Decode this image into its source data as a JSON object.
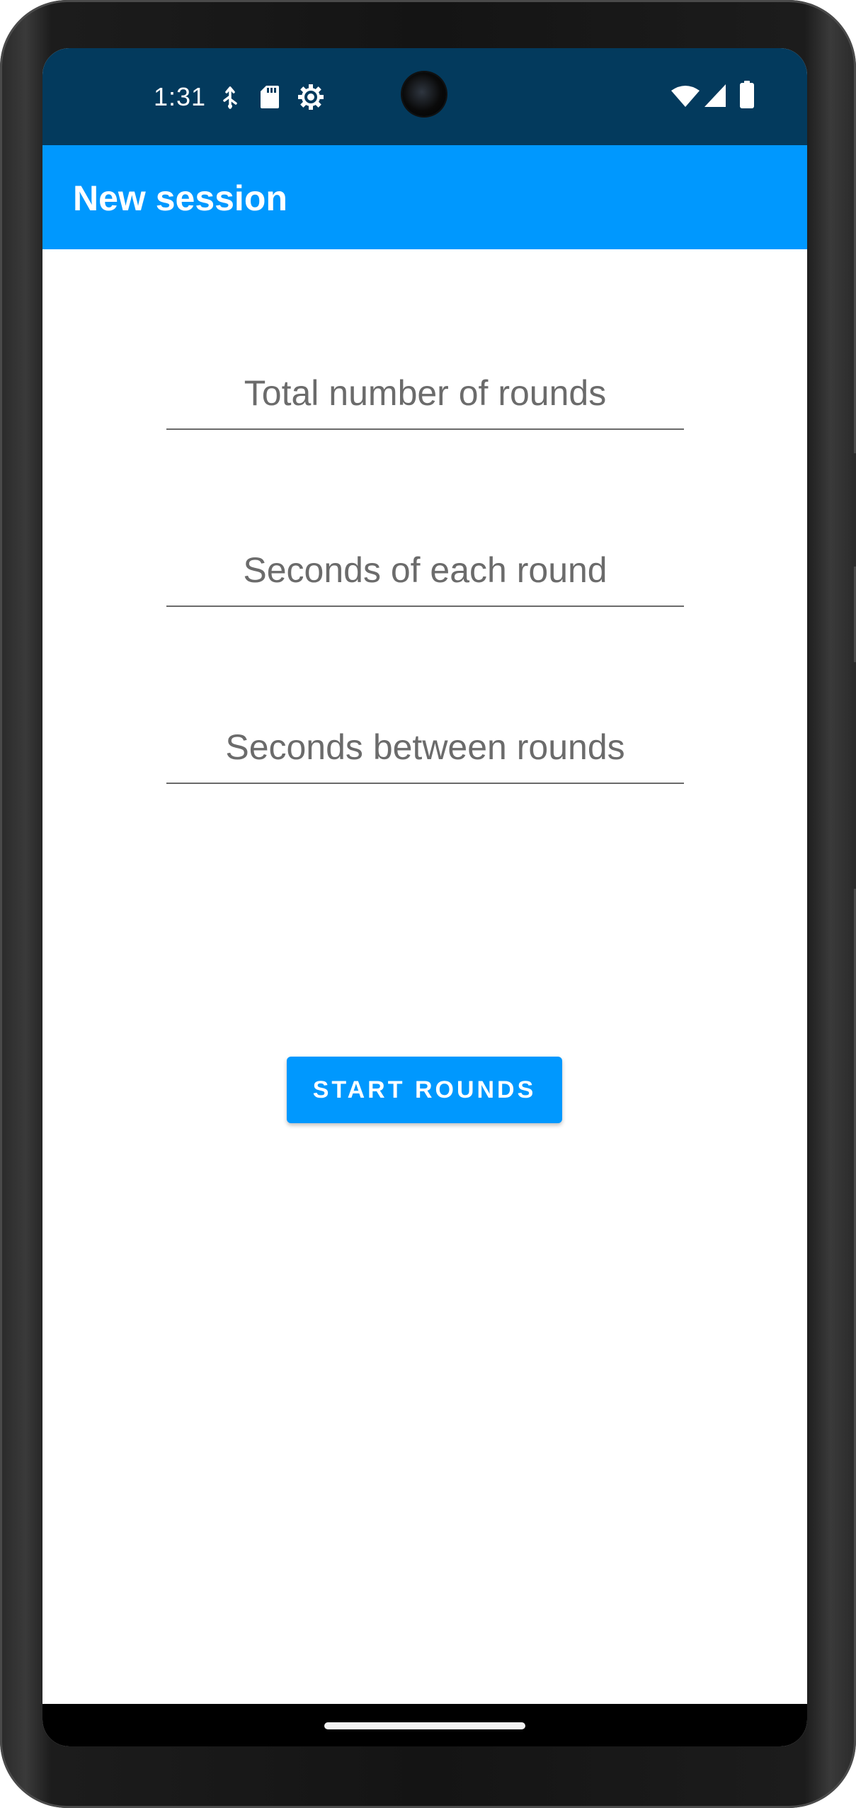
{
  "status_bar": {
    "time": "1:31",
    "left_icons": [
      "usb-debug-icon",
      "sd-card-icon",
      "settings-gear-icon"
    ],
    "right_icons": [
      "wifi-icon",
      "cellular-signal-icon",
      "battery-icon"
    ],
    "background_color": "#033a5d"
  },
  "app_bar": {
    "title": "New session",
    "background_color": "#0098fe"
  },
  "form": {
    "total_rounds": {
      "placeholder": "Total number of rounds",
      "value": ""
    },
    "round_seconds": {
      "placeholder": "Seconds of each round",
      "value": ""
    },
    "rest_seconds": {
      "placeholder": "Seconds between rounds",
      "value": ""
    }
  },
  "start_button": {
    "label": "START ROUNDS",
    "color": "#0098fe"
  }
}
